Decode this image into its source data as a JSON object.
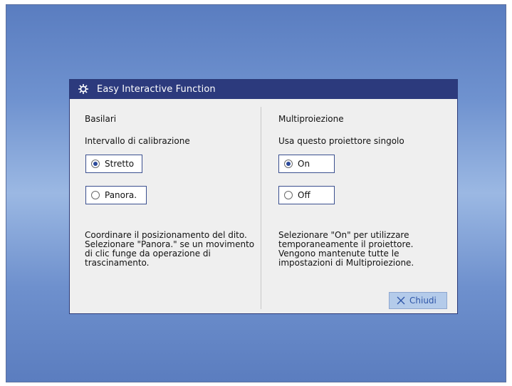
{
  "colors": {
    "title_bar": "#2c3a7d",
    "dialog_bg": "#efefef",
    "desktop_top": "#5a7dc0",
    "desktop_mid": "#9bb8e3",
    "close_button_bg": "#b4cbea",
    "close_button_text": "#2f56a8"
  },
  "dialog": {
    "title": "Easy Interactive Function",
    "title_icon": "gear-icon"
  },
  "left": {
    "section_title": "Basilari",
    "setting_label": "Intervallo di calibrazione",
    "options": [
      {
        "label": "Stretto",
        "selected": true
      },
      {
        "label": "Panora.",
        "selected": false
      }
    ],
    "description": "Coordinare il posizionamento del dito.\nSelezionare \"Panora.\" se un movimento\ndi clic funge da operazione di\ntrascinamento."
  },
  "right": {
    "section_title": "Multiproiezione",
    "setting_label": "Usa questo proiettore singolo",
    "options": [
      {
        "label": "On",
        "selected": true
      },
      {
        "label": "Off",
        "selected": false
      }
    ],
    "description": "Selezionare \"On\" per utilizzare\ntemporaneamente il proiettore.\nVengono mantenute tutte le\nimpostazioni di Multiproiezione."
  },
  "close_button": {
    "label": "Chiudi",
    "icon": "close-icon"
  }
}
